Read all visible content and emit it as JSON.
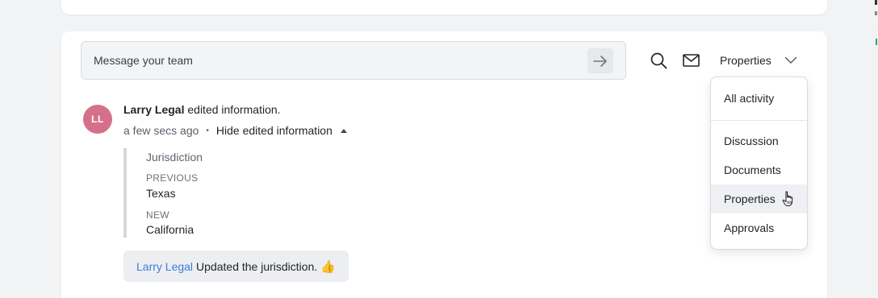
{
  "composer": {
    "placeholder": "Message your team"
  },
  "toolbar": {
    "filter_label": "Properties"
  },
  "activity": {
    "avatar_initials": "LL",
    "actor": "Larry Legal",
    "action": " edited information.",
    "time": "a few secs ago",
    "separator": "•",
    "toggle_label": "Hide edited information",
    "change": {
      "field": "Jurisdiction",
      "previous_label": "PREVIOUS",
      "previous_value": "Texas",
      "new_label": "NEW",
      "new_value": "California"
    },
    "comment": {
      "mention": "Larry Legal",
      "text": "Updated the jurisdiction.",
      "emoji": "👍"
    }
  },
  "filter_menu": {
    "items": [
      {
        "label": "All activity"
      },
      {
        "label": "Discussion"
      },
      {
        "label": "Documents"
      },
      {
        "label": "Properties"
      },
      {
        "label": "Approvals"
      }
    ],
    "active_index": 3
  },
  "colors": {
    "avatar": "#d4708a",
    "mention": "#3b7ddd"
  }
}
